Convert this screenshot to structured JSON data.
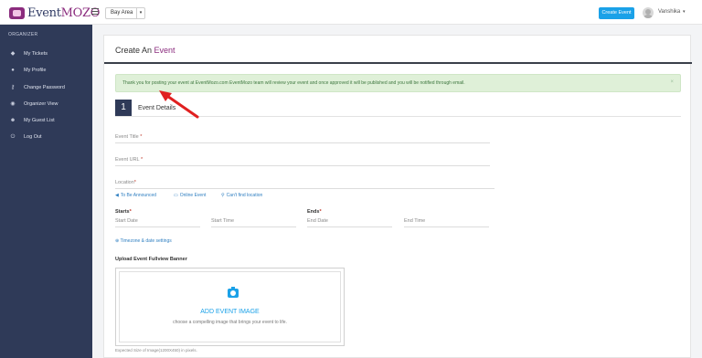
{
  "header": {
    "brand_prefix": "Event",
    "brand_suffix": "MOZO",
    "city": "Bay Area",
    "create_event_label": "Create Event",
    "user_name": "Vanshika"
  },
  "sidebar": {
    "heading": "ORGANIZER",
    "items": [
      {
        "label": "My Tickets",
        "icon": "ticket-icon"
      },
      {
        "label": "My Profile",
        "icon": "user-icon"
      },
      {
        "label": "Change Password",
        "icon": "key-icon"
      },
      {
        "label": "Organizer View",
        "icon": "eye-icon"
      },
      {
        "label": "My Guest List",
        "icon": "users-icon"
      },
      {
        "label": "Log Out",
        "icon": "logout-icon"
      }
    ]
  },
  "main": {
    "title_prefix": "Create An",
    "title_accent": "Event",
    "alert_text": "Thank you for posting your event at EventMozo.com EventMozo team will review your event and once approved it will be published and you will be notified through email.",
    "alert_close": "×",
    "step_number": "1",
    "step_label": "Event Details",
    "fields": {
      "event_title": "Event Title",
      "event_url": "Event URL",
      "location": "Location",
      "required_mark": "*"
    },
    "location_options": {
      "tba": "To Be Announced",
      "online": "Online Event",
      "cant_find": "Can't find location"
    },
    "datetime": {
      "starts": "Starts",
      "ends": "Ends",
      "start_date": "Start Date",
      "start_time": "Start Time",
      "end_date": "End Date",
      "end_time": "End Time",
      "timezone_link": "Timezone & date settings"
    },
    "upload": {
      "title": "Upload Event Fullview Banner",
      "add_image": "ADD EVENT IMAGE",
      "subtitle": "choose a compelling image that brings your event to life.",
      "expected": "Expected Size of Image(1200X450) in pixels."
    }
  },
  "colors": {
    "brand": "#8b2c7e",
    "sidebar_bg": "#2f3a58",
    "primary_button": "#1aa1e8",
    "alert_bg": "#dff0d8",
    "arrow": "#e02020"
  }
}
